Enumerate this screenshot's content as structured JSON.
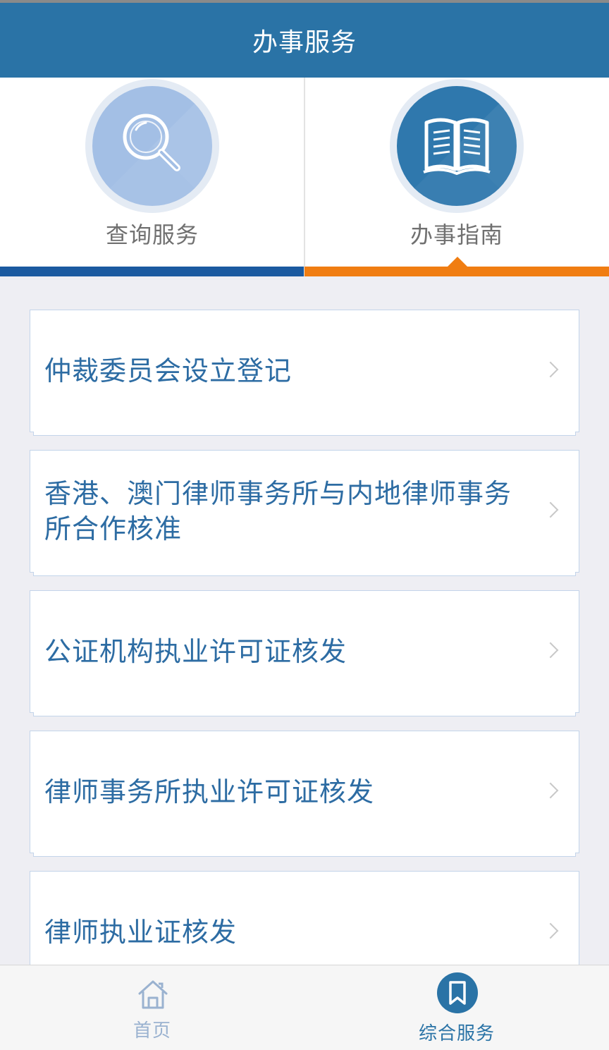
{
  "header": {
    "title": "办事服务"
  },
  "tabs": [
    {
      "label": "查询服务",
      "icon": "search-icon",
      "active": false
    },
    {
      "label": "办事指南",
      "icon": "book-icon",
      "active": true
    }
  ],
  "list": {
    "items": [
      {
        "label": "仲裁委员会设立登记"
      },
      {
        "label": "香港、澳门律师事务所与内地律师事务所合作核准"
      },
      {
        "label": "公证机构执业许可证核发"
      },
      {
        "label": "律师事务所执业许可证核发"
      },
      {
        "label": "律师执业证核发"
      }
    ]
  },
  "bottom_nav": {
    "items": [
      {
        "label": "首页",
        "icon": "home-icon",
        "active": false
      },
      {
        "label": "综合服务",
        "icon": "bookmark-icon",
        "active": true
      }
    ]
  },
  "colors": {
    "header_bg": "#2a73a6",
    "tab_left_bar": "#1b5aa0",
    "tab_right_bar": "#f07d12",
    "list_text": "#2d6ca3"
  }
}
